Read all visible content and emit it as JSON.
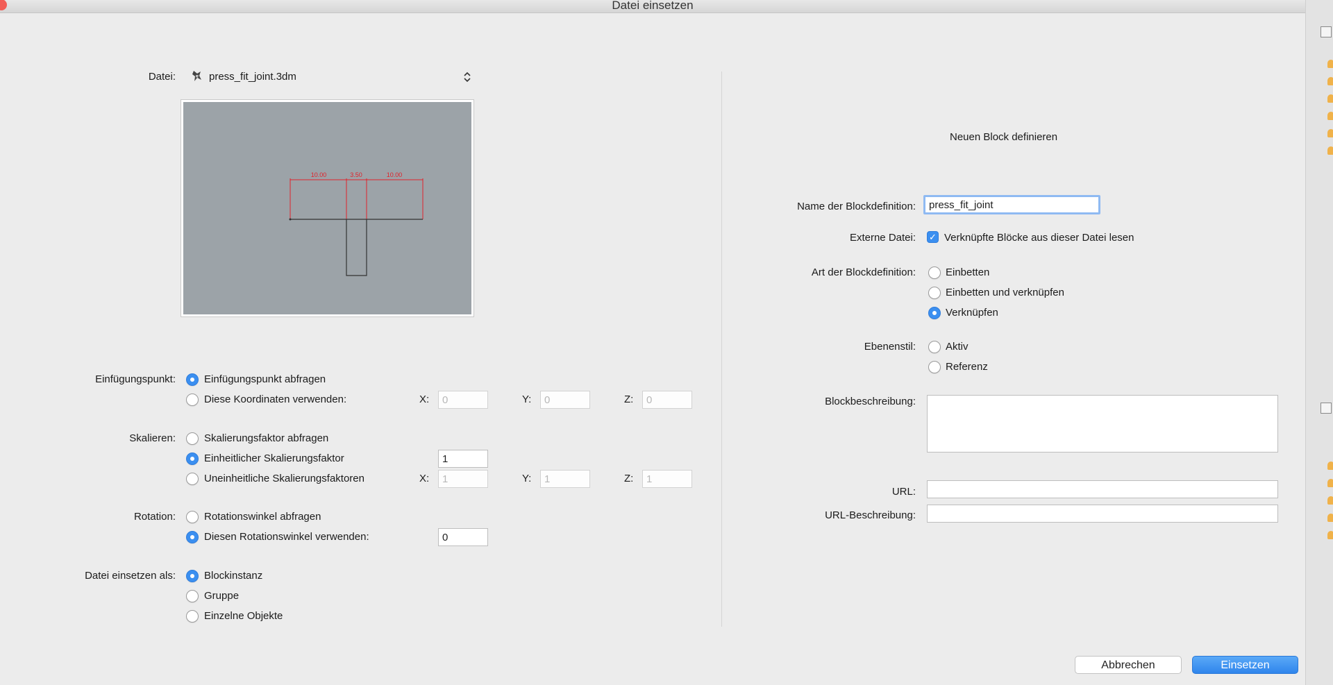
{
  "window": {
    "title": "Datei einsetzen"
  },
  "file": {
    "label": "Datei:",
    "name": "press_fit_joint.3dm",
    "chevron": "⌃⌄"
  },
  "preview": {
    "dimensions": [
      "10.00",
      "3.50",
      "10.00"
    ],
    "dimension_color": "#e0232b"
  },
  "insertion_point": {
    "label": "Einfügungspunkt:",
    "options": [
      "Einfügungspunkt abfragen",
      "Diese Koordinaten verwenden:"
    ],
    "selected": 0,
    "x_label": "X:",
    "y_label": "Y:",
    "z_label": "Z:",
    "x": "0",
    "y": "0",
    "z": "0"
  },
  "scale": {
    "label": "Skalieren:",
    "options": [
      "Skalierungsfaktor abfragen",
      "Einheitlicher Skalierungsfaktor",
      "Uneinheitliche Skalierungsfaktoren"
    ],
    "selected": 1,
    "uniform_value": "1",
    "x_label": "X:",
    "y_label": "Y:",
    "z_label": "Z:",
    "x": "1",
    "y": "1",
    "z": "1"
  },
  "rotation": {
    "label": "Rotation:",
    "options": [
      "Rotationswinkel abfragen",
      "Diesen Rotationswinkel verwenden:"
    ],
    "selected": 1,
    "value": "0"
  },
  "insert_as": {
    "label": "Datei einsetzen als:",
    "options": [
      "Blockinstanz",
      "Gruppe",
      "Einzelne Objekte"
    ],
    "selected": 0
  },
  "block": {
    "heading": "Neuen Block definieren",
    "name_label": "Name der Blockdefinition:",
    "name_value": "press_fit_joint",
    "external_label": "Externe Datei:",
    "external_checkbox_label": "Verknüpfte Blöcke aus dieser Datei lesen",
    "external_checked": true,
    "type_label": "Art der Blockdefinition:",
    "type_options": [
      "Einbetten",
      "Einbetten und verknüpfen",
      "Verknüpfen"
    ],
    "type_selected": 2,
    "layer_label": "Ebenenstil:",
    "layer_options": [
      "Aktiv",
      "Referenz"
    ],
    "layer_selected": -1,
    "description_label": "Blockbeschreibung:",
    "description_value": "",
    "url_label": "URL:",
    "url_value": "",
    "url_desc_label": "URL-Beschreibung:",
    "url_desc_value": ""
  },
  "buttons": {
    "cancel": "Abbrechen",
    "ok": "Einsetzen"
  },
  "colors": {
    "accent": "#3b8ff0",
    "preview_bg": "#9ca3a8"
  }
}
